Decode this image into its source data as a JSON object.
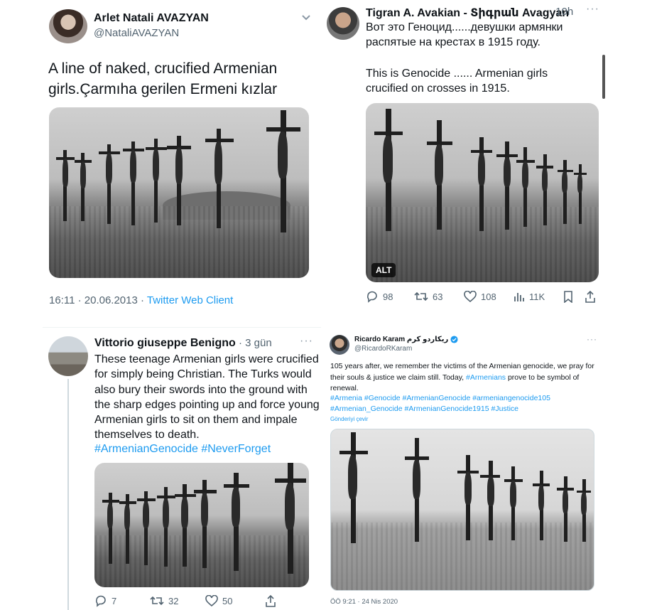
{
  "tweet1": {
    "name": "Arlet Natali AVAZYAN",
    "handle": "@NataliAVAZYAN",
    "text": "A line of naked, crucified Armenian girls.Çarmıha gerilen Ermeni kızlar",
    "time": "16:11 · 20.06.2013 · ",
    "client": "Twitter Web Client"
  },
  "tweet2": {
    "name": "Tigran A. Avakian - Տիգրան Avagyan",
    "time": "· 10h",
    "text_ru": "Вот это Геноцид......девушки армянки распятые на крестах в 1915 году.",
    "text_en": "This is Genocide ...... Armenian girls crucified on crosses in 1915.",
    "alt": "ALT",
    "replies": "98",
    "retweets": "63",
    "likes": "108",
    "views": "11K"
  },
  "tweet3": {
    "name": "Vittorio giuseppe Benigno",
    "time": "· 3 gün",
    "text": "These teenage Armenian girls were crucified for simply being Christian. The Turks would also bury their swords into the ground with the sharp edges pointing up and force young Armenian girls to sit on them and impale themselves to death.",
    "hashtags": "#ArmenianGenocide #NeverForget",
    "replies": "7",
    "retweets": "32",
    "likes": "50"
  },
  "tweet4": {
    "name": "Ricardo Karam ريكاردو كرم",
    "handle": "@RicardoRKaram",
    "text_a": "105 years after, we remember the victims of the Armenian genocide, we pray for their souls & justice we claim still. Today, ",
    "text_link": "#Armenians",
    "text_b": " prove to be symbol of renewal.",
    "hashtags_1": "#Armenia #Genocide #ArmenianGenocide #armeniangenocide105",
    "hashtags_2": "#Armenian_Genocide #ArmenianGenocide1915 #Justice",
    "translate": "Gönderiyi çevir",
    "time": "ÖÖ 9:21 · 24 Nis 2020"
  },
  "colors": {
    "link": "#1d9bf0",
    "muted": "#536471",
    "verified": "#1d9bf0"
  }
}
